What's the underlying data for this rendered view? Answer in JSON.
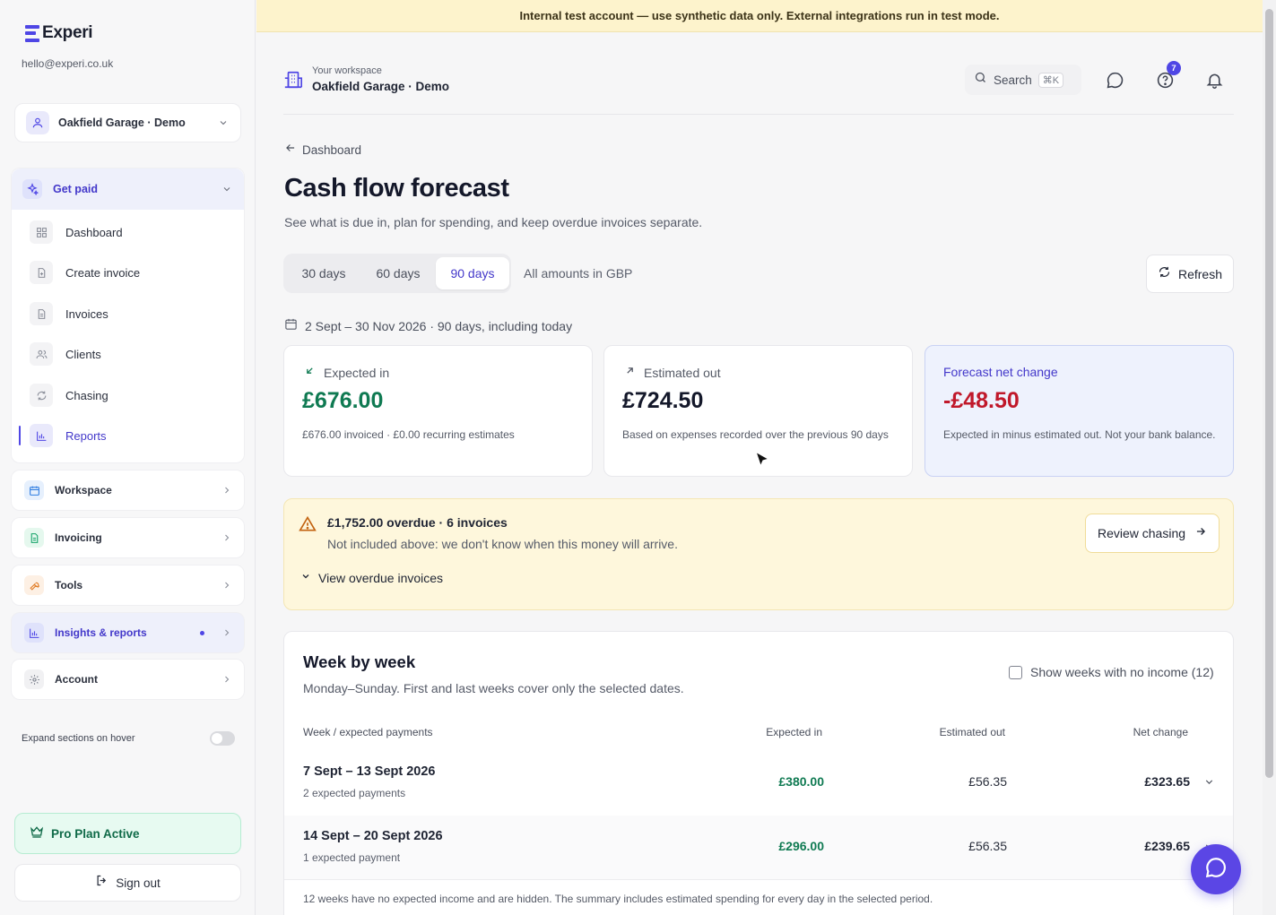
{
  "sidebar": {
    "brand": "Experi",
    "email": "hello@experi.co.uk",
    "org": "Oakfield Garage · Demo",
    "get_paid": {
      "label": "Get paid",
      "items": [
        {
          "label": "Dashboard",
          "icon": "grid-icon"
        },
        {
          "label": "Create invoice",
          "icon": "file-plus-icon"
        },
        {
          "label": "Invoices",
          "icon": "document-icon"
        },
        {
          "label": "Clients",
          "icon": "users-icon"
        },
        {
          "label": "Chasing",
          "icon": "refresh-icon"
        },
        {
          "label": "Reports",
          "icon": "bar-chart-icon",
          "active": true
        }
      ]
    },
    "groups": [
      {
        "label": "Workspace",
        "icon": "calendar-icon"
      },
      {
        "label": "Invoicing",
        "icon": "document-icon"
      },
      {
        "label": "Tools",
        "icon": "wrench-icon"
      },
      {
        "label": "Insights & reports",
        "icon": "bar-chart-icon",
        "highlighted": true
      },
      {
        "label": "Account",
        "icon": "gear-icon"
      }
    ],
    "expand_on_hover": "Expand sections on hover",
    "pro_plan": "Pro Plan Active",
    "sign_out": "Sign out"
  },
  "banner": "Internal test account — use synthetic data only. External integrations run in test mode.",
  "topbar": {
    "workspace_label": "Your workspace",
    "workspace_name": "Oakfield Garage · Demo",
    "search_label": "Search",
    "search_shortcut": "⌘K",
    "help_badge": "7"
  },
  "page": {
    "back_label": "Dashboard",
    "title": "Cash flow forecast",
    "subtitle": "See what is due in, plan for spending, and keep overdue invoices separate.",
    "ranges": [
      "30 days",
      "60 days",
      "90 days"
    ],
    "selected_range": "90 days",
    "currency_note": "All amounts in GBP",
    "refresh_label": "Refresh",
    "date_range": "2 Sept – 30 Nov 2026 · 90 days, including today"
  },
  "cards": {
    "expected_in": {
      "label": "Expected in",
      "amount": "£676.00",
      "note": "£676.00 invoiced · £0.00 recurring estimates"
    },
    "estimated_out": {
      "label": "Estimated out",
      "amount": "£724.50",
      "note": "Based on expenses recorded over the previous 90 days"
    },
    "forecast": {
      "label": "Forecast net change",
      "amount": "-£48.50",
      "note": "Expected in minus estimated out. Not your bank balance."
    }
  },
  "overdue": {
    "title": "£1,752.00 overdue · 6 invoices",
    "desc": "Not included above: we don't know when this money will arrive.",
    "view_label": "View overdue invoices",
    "review_label": "Review chasing"
  },
  "weeks": {
    "title": "Week by week",
    "subtitle": "Monday–Sunday. First and last weeks cover only the selected dates.",
    "show_empty_label": "Show weeks with no income (12)",
    "columns": [
      "Week / expected payments",
      "Expected in",
      "Estimated out",
      "Net change"
    ],
    "rows": [
      {
        "week": "7 Sept – 13 Sept 2026",
        "count": "2 expected payments",
        "in": "£380.00",
        "out": "£56.35",
        "net": "£323.65"
      },
      {
        "week": "14 Sept – 20 Sept 2026",
        "count": "1 expected payment",
        "in": "£296.00",
        "out": "£56.35",
        "net": "£239.65"
      }
    ],
    "footer": "12 weeks have no expected income and are hidden. The summary includes estimated spending for every day in the selected period."
  },
  "colors": {
    "accent": "#4f46e5",
    "positive": "#0f7a52",
    "negative": "#c0182a",
    "banner": "#fdf3cc"
  }
}
